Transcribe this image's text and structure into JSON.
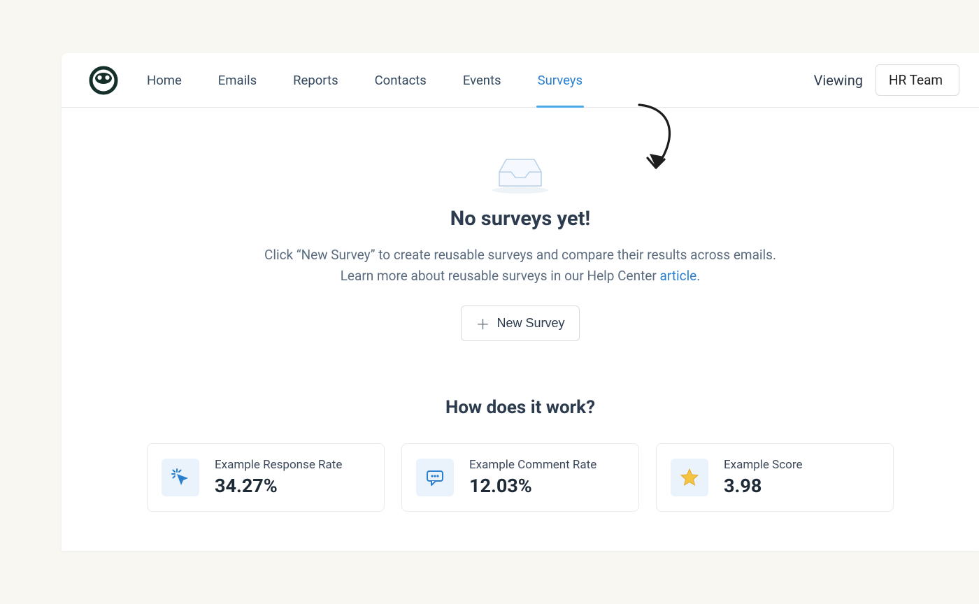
{
  "nav": {
    "items": [
      {
        "label": "Home",
        "active": false
      },
      {
        "label": "Emails",
        "active": false
      },
      {
        "label": "Reports",
        "active": false
      },
      {
        "label": "Contacts",
        "active": false
      },
      {
        "label": "Events",
        "active": false
      },
      {
        "label": "Surveys",
        "active": true
      }
    ]
  },
  "header": {
    "viewing_label": "Viewing",
    "team_selected": "HR Team"
  },
  "empty_state": {
    "title": "No surveys yet!",
    "line1": "Click “New Survey” to create reusable surveys and compare their results across emails.",
    "line2_prefix": "Learn more about reusable surveys in our Help Center ",
    "line2_link": "article",
    "line2_suffix": ".",
    "button_label": "New Survey"
  },
  "how": {
    "title": "How does it work?",
    "cards": [
      {
        "icon": "click-icon",
        "label": "Example Response Rate",
        "value": "34.27%"
      },
      {
        "icon": "comment-icon",
        "label": "Example Comment Rate",
        "value": "12.03%"
      },
      {
        "icon": "star-icon",
        "label": "Example Score",
        "value": "3.98"
      }
    ]
  },
  "colors": {
    "accent": "#2a7fcf",
    "text_dark": "#2d3b4e",
    "text_muted": "#5b6b7f"
  }
}
